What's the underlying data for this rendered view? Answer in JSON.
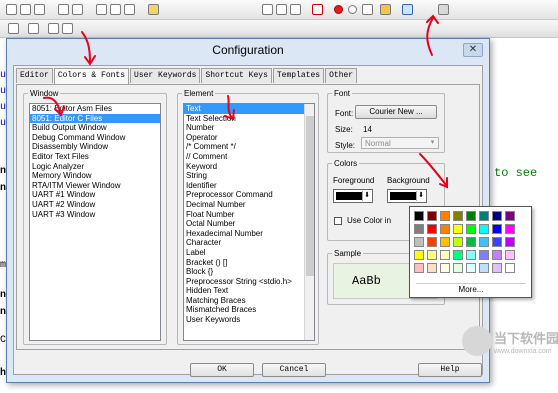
{
  "background": {
    "code_lines": [
      "ude",
      "ude",
      "ude",
      "ude",
      "nec",
      "nec",
      "ma",
      "ns",
      "ns",
      "CD",
      "hi"
    ],
    "bg_text_right": "d to see",
    "bg_text_right2": "to see"
  },
  "dialog": {
    "title": "Configuration",
    "close_glyph": "✕",
    "tabs": [
      "Editor",
      "Colors & Fonts",
      "User Keywords",
      "Shortcut Keys",
      "Templates",
      "Other"
    ],
    "window_group": {
      "title": "Window",
      "items": [
        "8051: Editor Asm Files",
        "8051: Editor C Files",
        "Build Output Window",
        "Debug Command Window",
        "Disassembly Window",
        "Editor Text Files",
        "Logic Analyzer",
        "Memory Window",
        "RTA/ITM Viewer Window",
        "UART #1 Window",
        "UART #2 Window",
        "UART #3 Window"
      ],
      "selected_index": 1
    },
    "element_group": {
      "title": "Element",
      "items": [
        "Text",
        "Text Selection",
        "Number",
        "Operator",
        "/* Comment */",
        "// Comment",
        "Keyword",
        "String",
        "Identifier",
        "Preprocessor Command",
        "Decimal Number",
        "Float Number",
        "Octal Number",
        "Hexadecimal Number",
        "Character",
        "Label",
        "Bracket () []",
        "Block {}",
        "Preprocessor String <stdio.h>",
        "Hidden Text",
        "Matching Braces",
        "Mismatched Braces",
        "User Keywords"
      ],
      "selected_index": 0
    },
    "font_group": {
      "title": "Font",
      "font_label": "Font:",
      "font_button": "Courier New ...",
      "size_label": "Size:",
      "size_value": "14",
      "style_label": "Style:",
      "style_value": "Normal"
    },
    "colors_group": {
      "title": "Colors",
      "foreground_label": "Foreground",
      "background_label": "Background",
      "foreground_color": "#000000",
      "background_color": "#000000",
      "use_color_label": "Use Color in"
    },
    "sample_group": {
      "title": "Sample",
      "sample_text": "AaBb"
    },
    "palette": {
      "colors": [
        "#000000",
        "#7f0000",
        "#ff7f00",
        "#7f7f00",
        "#007f00",
        "#007f7f",
        "#00007f",
        "#7f007f",
        "#7f7f7f",
        "#ff0000",
        "#ff7f00",
        "#ffff00",
        "#00ff00",
        "#00ffff",
        "#0000ff",
        "#ff00ff",
        "#bfbfbf",
        "#ff4000",
        "#ffbf00",
        "#bfff00",
        "#00bf40",
        "#40bfff",
        "#4040ff",
        "#bf00ff",
        "#ffff00",
        "#ffff7f",
        "#ffffbf",
        "#00ff7f",
        "#7fffff",
        "#7f7fff",
        "#bf7fff",
        "#ffbfff",
        "#ffbfbf",
        "#ffdfbf",
        "#ffffdf",
        "#dfffdf",
        "#dfffff",
        "#bfdfff",
        "#dfbfff",
        "#ffffff"
      ],
      "more_label": "More..."
    },
    "buttons": {
      "ok": "OK",
      "cancel": "Cancel",
      "help": "Help"
    }
  },
  "watermark": {
    "text": "当下软件园",
    "url": "www.downxia.com"
  },
  "accent": {
    "arrow": "#e8001c",
    "selection": "#3399ff"
  }
}
